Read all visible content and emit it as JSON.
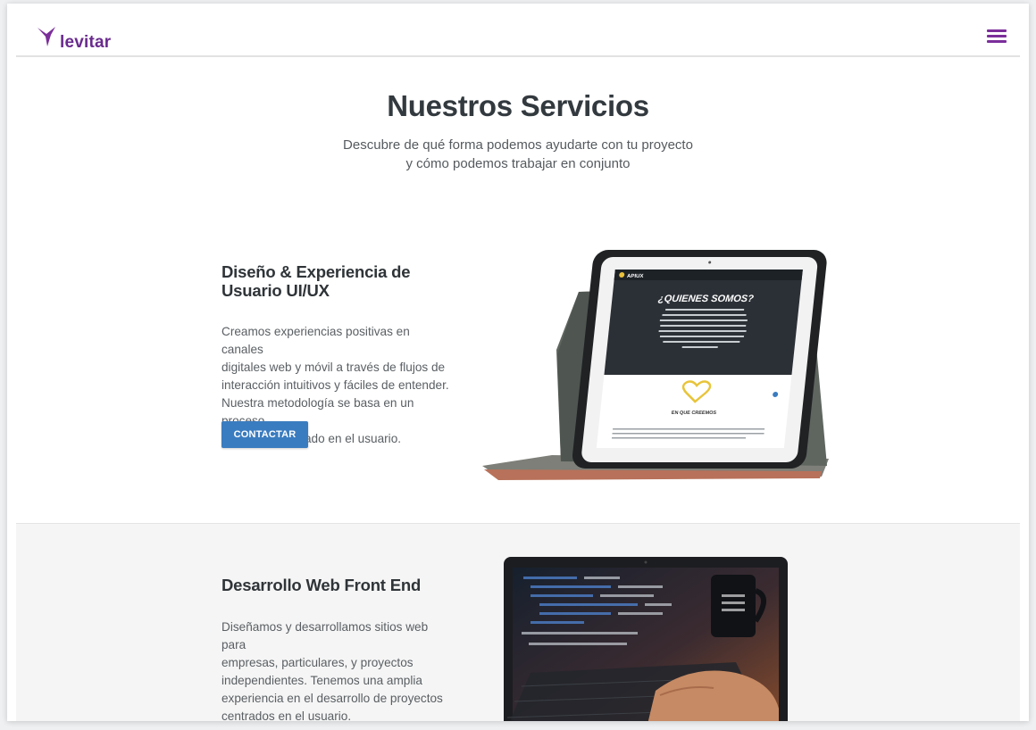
{
  "brand": {
    "logo_text": "levitar",
    "color": "#6a2b8e"
  },
  "header": {
    "menu_icon": "hamburger-menu-icon"
  },
  "hero": {
    "title": "Nuestros Servicios",
    "subtitle_line1": "Descubre de qué forma podemos ayudarte con tu proyecto",
    "subtitle_line2": "y cómo podemos trabajar en conjunto"
  },
  "services": [
    {
      "title_line1": "Diseño & Experiencia de",
      "title_line2": "Usuario UI/UX",
      "description": [
        "Creamos experiencias positivas en canales",
        "digitales web y móvil a través de flujos de",
        "interacción intuitivos y fáciles de entender.",
        "Nuestra metodología se basa en un proceso",
        "de diseño centrado en el usuario."
      ],
      "button_label": "CONTACTAR",
      "image": {
        "brand": "APIUX",
        "heading": "¿QUIENES SOMOS?",
        "section_label": "EN QUE CREEMOS"
      }
    },
    {
      "title": "Desarrollo Web Front End",
      "description": [
        "Diseñamos y desarrollamos sitios web para",
        "empresas, particulares, y proyectos",
        "independientes. Tenemos una amplia",
        "experiencia en el desarrollo de proyectos",
        "centrados en el usuario."
      ]
    }
  ],
  "colors": {
    "accent": "#3a7cc0",
    "brand": "#6a2b8e",
    "heading": "#333a3f"
  }
}
